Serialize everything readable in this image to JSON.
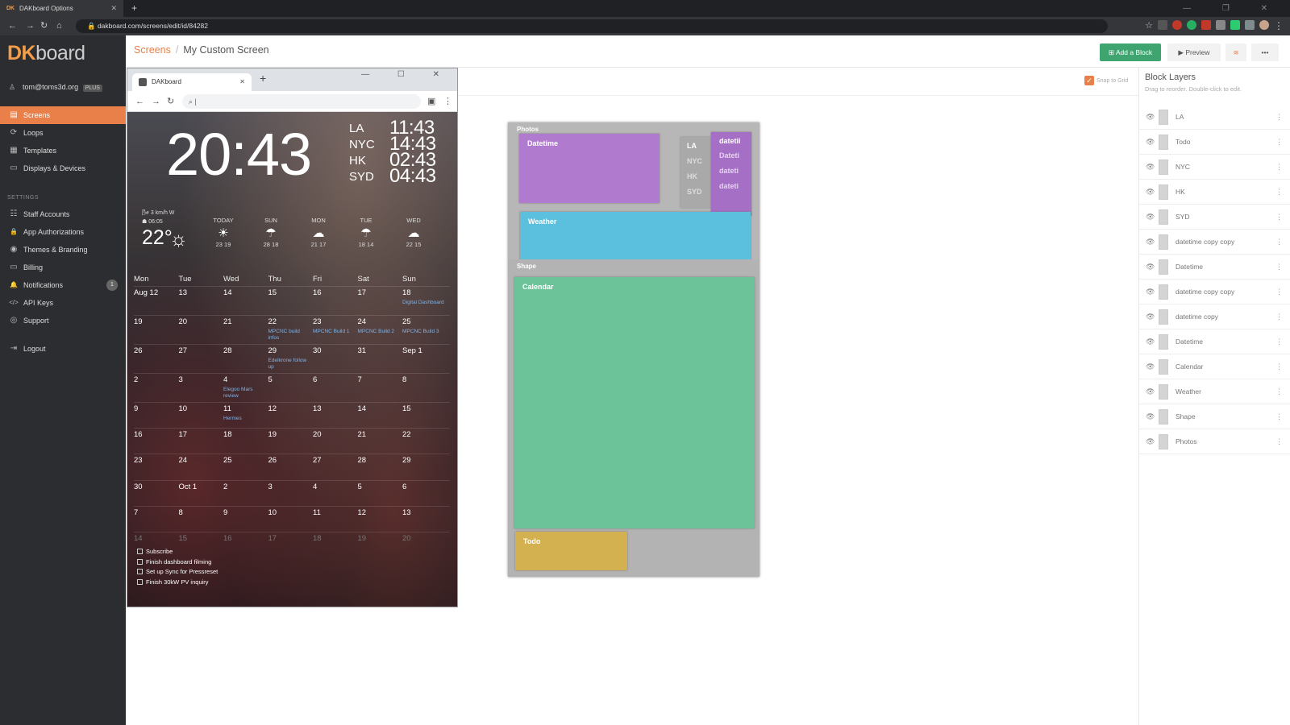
{
  "browser": {
    "tab_title": "DAKboard Options",
    "tab_favicon": "DK",
    "new_tab": "+",
    "url": "dakboard.com/screens/edit/id/84282",
    "window_controls": "— ❐ ✕"
  },
  "sidebar": {
    "logo_dk": "DK",
    "logo_board": "board",
    "user_email": "tom@toms3d.org",
    "user_badge": "PLUS",
    "settings_label": "SETTINGS",
    "items": [
      {
        "label": "Screens",
        "icon": "screens-icon",
        "glyph": "▤"
      },
      {
        "label": "Loops",
        "icon": "loop-icon",
        "glyph": "⟳"
      },
      {
        "label": "Templates",
        "icon": "templates-icon",
        "glyph": "▦"
      },
      {
        "label": "Displays & Devices",
        "icon": "display-icon",
        "glyph": "▭"
      },
      {
        "label": "Staff Accounts",
        "icon": "users-icon",
        "glyph": "☷"
      },
      {
        "label": "App Authorizations",
        "icon": "lock-icon",
        "glyph": "🔒"
      },
      {
        "label": "Themes & Branding",
        "icon": "palette-icon",
        "glyph": "◉"
      },
      {
        "label": "Billing",
        "icon": "card-icon",
        "glyph": "▭"
      },
      {
        "label": "Notifications",
        "icon": "bell-icon",
        "glyph": "🔔"
      },
      {
        "label": "API Keys",
        "icon": "code-icon",
        "glyph": "</>"
      },
      {
        "label": "Support",
        "icon": "support-icon",
        "glyph": "◎"
      },
      {
        "label": "Logout",
        "icon": "logout-icon",
        "glyph": "⇥"
      }
    ],
    "notification_count": "1"
  },
  "header": {
    "crumb_root": "Screens",
    "crumb_sep": "/",
    "crumb_current": "My Custom Screen",
    "add_block": "⊞ Add a Block",
    "preview": "▶ Preview",
    "layers_icon": "≋",
    "more": "•••"
  },
  "canvas": {
    "snap_check": "✓",
    "snap_label": "Snap to Grid"
  },
  "layers_panel": {
    "title": "Block Layers",
    "subtitle": "Drag to reorder. Double-click to edit.",
    "eye": "👁",
    "dots": "⋮",
    "items": [
      "LA",
      "Todo",
      "NYC",
      "HK",
      "SYD",
      "datetime copy copy",
      "Datetime",
      "datetime copy copy",
      "datetime copy",
      "Datetime",
      "Calendar",
      "Weather",
      "Shape",
      "Photos"
    ]
  },
  "dak_window": {
    "tab_title": "DAKboard",
    "tab_close": "✕",
    "new_tab": "+",
    "controls": "— ☐ ✕",
    "back": "←",
    "forward": "→",
    "reload": "↻",
    "search_glyph": "⌕ |",
    "profile": "▣",
    "menu": "⋮",
    "clock": "20:43",
    "world_clocks": [
      {
        "city": "LA",
        "time": "11:43"
      },
      {
        "city": "NYC",
        "time": "14:43"
      },
      {
        "city": "HK",
        "time": "02:43"
      },
      {
        "city": "SYD",
        "time": "04:43"
      }
    ],
    "wind": "🌬 3 km/h W",
    "sunrise": "☗ 06:05",
    "temp": "22°",
    "temp_glyph": "☼",
    "forecast": [
      {
        "day": "TODAY",
        "glyph": "☀",
        "range": "23 19"
      },
      {
        "day": "SUN",
        "glyph": "☂",
        "range": "28 18"
      },
      {
        "day": "MON",
        "glyph": "☁",
        "range": "21 17"
      },
      {
        "day": "TUE",
        "glyph": "☂",
        "range": "18 14"
      },
      {
        "day": "WED",
        "glyph": "☁",
        "range": "22 15"
      }
    ],
    "calendar_days": [
      "Mon",
      "Tue",
      "Wed",
      "Thu",
      "Fri",
      "Sat",
      "Sun"
    ],
    "calendar_weeks": [
      [
        {
          "d": "Aug 12"
        },
        {
          "d": "13"
        },
        {
          "d": "14"
        },
        {
          "d": "15"
        },
        {
          "d": "16"
        },
        {
          "d": "17"
        },
        {
          "d": "18",
          "ev": "Digital Dashboard"
        }
      ],
      [
        {
          "d": "19"
        },
        {
          "d": "20"
        },
        {
          "d": "21"
        },
        {
          "d": "22",
          "ev": "MPCNC build infos"
        },
        {
          "d": "23",
          "ev": "MPCNC Build 1"
        },
        {
          "d": "24",
          "ev": "MPCNC Build 2"
        },
        {
          "d": "25",
          "ev": "MPCNC Build 3"
        }
      ],
      [
        {
          "d": "26"
        },
        {
          "d": "27"
        },
        {
          "d": "28"
        },
        {
          "d": "29",
          "ev": "Edelkrone follow up"
        },
        {
          "d": "30"
        },
        {
          "d": "31"
        },
        {
          "d": "Sep 1"
        }
      ],
      [
        {
          "d": "2"
        },
        {
          "d": "3"
        },
        {
          "d": "4",
          "ev": "Elegoo Mars review"
        },
        {
          "d": "5"
        },
        {
          "d": "6"
        },
        {
          "d": "7"
        },
        {
          "d": "8"
        }
      ],
      [
        {
          "d": "9"
        },
        {
          "d": "10"
        },
        {
          "d": "11",
          "ev": "Hermes"
        },
        {
          "d": "12"
        },
        {
          "d": "13"
        },
        {
          "d": "14"
        },
        {
          "d": "15"
        }
      ],
      [
        {
          "d": "16"
        },
        {
          "d": "17"
        },
        {
          "d": "18"
        },
        {
          "d": "19"
        },
        {
          "d": "20"
        },
        {
          "d": "21"
        },
        {
          "d": "22"
        }
      ],
      [
        {
          "d": "23"
        },
        {
          "d": "24"
        },
        {
          "d": "25"
        },
        {
          "d": "26"
        },
        {
          "d": "27"
        },
        {
          "d": "28"
        },
        {
          "d": "29"
        }
      ],
      [
        {
          "d": "30"
        },
        {
          "d": "Oct 1"
        },
        {
          "d": "2"
        },
        {
          "d": "3"
        },
        {
          "d": "4"
        },
        {
          "d": "5"
        },
        {
          "d": "6"
        }
      ],
      [
        {
          "d": "7"
        },
        {
          "d": "8"
        },
        {
          "d": "9"
        },
        {
          "d": "10"
        },
        {
          "d": "11"
        },
        {
          "d": "12"
        },
        {
          "d": "13"
        }
      ],
      [
        {
          "d": "14"
        },
        {
          "d": "15"
        },
        {
          "d": "16"
        },
        {
          "d": "17"
        },
        {
          "d": "18"
        },
        {
          "d": "19"
        },
        {
          "d": "20"
        }
      ]
    ],
    "todos": [
      "Subscribe",
      "Finish dashboard filming",
      "Set up Sync for Pressreset",
      "Finish 30kW PV inquiry"
    ]
  },
  "layout_preview": {
    "photos": "Photos",
    "datetime": "Datetime",
    "la": "LA",
    "nyc": "NYC",
    "hk": "HK",
    "syd": "SYD",
    "dt1": "datetii",
    "dt2": "Dateti",
    "dt3": "dateti",
    "dt4": "dateti",
    "weather": "Weather",
    "shape": "Shape",
    "calendar": "Calendar",
    "todo": "Todo",
    "colors": {
      "datetime": "#b07bcf",
      "weather": "#5bc0de",
      "calendar": "#6cc39a",
      "todo": "#d4b150"
    }
  }
}
